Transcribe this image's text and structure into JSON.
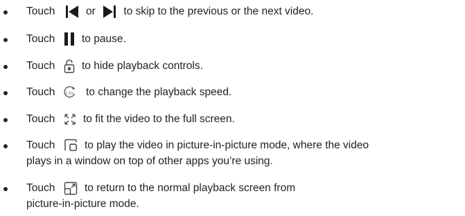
{
  "items": [
    {
      "touch": "Touch",
      "icon": "skip-previous-icon",
      "or": "or",
      "icon2": "skip-next-icon",
      "text": "to skip to the previous or the next video."
    },
    {
      "touch": "Touch",
      "icon": "pause-icon",
      "text": "to pause."
    },
    {
      "touch": "Touch",
      "icon": "lock-icon",
      "text": "to hide playback controls."
    },
    {
      "touch": "Touch",
      "icon": "playback-speed-icon",
      "icon_label": "1.0x",
      "text": "to change the playback speed."
    },
    {
      "touch": "Touch",
      "icon": "fullscreen-icon",
      "text": "to fit the video to the full screen."
    },
    {
      "touch": "Touch",
      "icon": "picture-in-picture-icon",
      "text": "to play the video in picture-in-picture mode, where the video",
      "text_line2": "plays in a window on top of other apps you’re using."
    },
    {
      "touch": "Touch",
      "icon": "return-to-full-icon",
      "text": "to return to the normal playback screen from",
      "text_line2": "picture-in-picture mode."
    }
  ]
}
